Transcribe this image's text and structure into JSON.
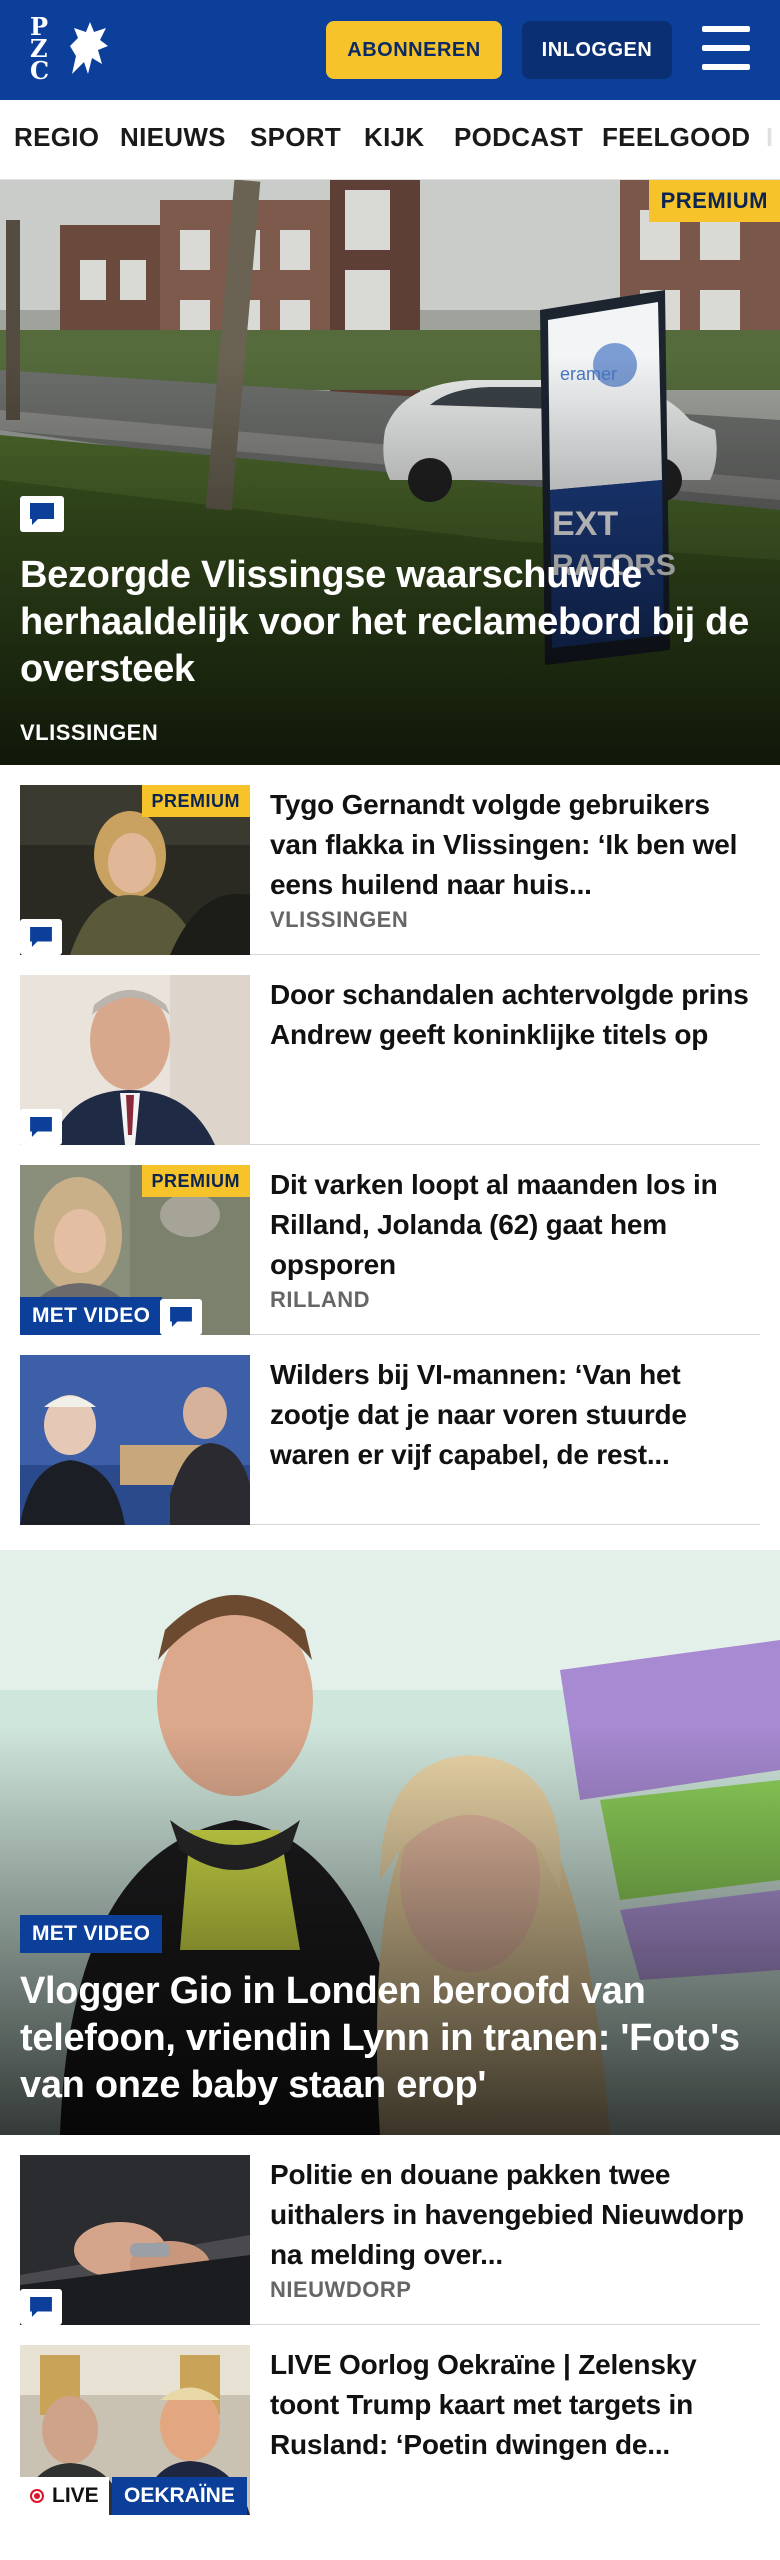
{
  "header": {
    "logo_text": "PZC",
    "subscribe_label": "ABONNEREN",
    "login_label": "INLOGGEN",
    "menu_icon": "hamburger-menu-icon"
  },
  "nav": {
    "items": [
      "REGIO",
      "NIEUWS",
      "SPORT",
      "KIJK",
      "PODCAST",
      "FEELGOOD",
      "I"
    ]
  },
  "hero1": {
    "badge": "PREMIUM",
    "title": "Bezorgde Vlissingse waarschuwde herhaaldelijk voor het reclamebord bij de oversteek",
    "location": "VLISSINGEN",
    "billboard_text": "EXT\nRATORS",
    "billboard_brand": "eramer"
  },
  "articles_a": [
    {
      "title": "Tygo Gernandt volgde gebruikers van flakka in Vlissingen: ‘Ik ben wel eens huilend naar huis...",
      "location": "VLISSINGEN",
      "premium": "PREMIUM"
    },
    {
      "title": "Door schandalen achtervolgde prins Andrew geeft koninklijke titels op",
      "location": ""
    },
    {
      "title": "Dit varken loopt al maanden los in Rilland, Jolanda (62) gaat hem opsporen",
      "location": "RILLAND",
      "premium": "PREMIUM",
      "video": "MET VIDEO"
    },
    {
      "title": "Wilders bij VI-mannen: ‘Van het zootje dat je naar voren stuurde waren er vijf capabel, de rest...",
      "location": ""
    }
  ],
  "hero2": {
    "video": "MET VIDEO",
    "title": "Vlogger Gio in Londen beroofd van telefoon, vriendin Lynn in tranen: 'Foto's van onze baby staan erop'"
  },
  "articles_b": [
    {
      "title": "Politie en douane pakken twee uithalers in havengebied Nieuwdorp na melding over...",
      "location": "NIEUWDORP"
    },
    {
      "title": "LIVE Oorlog Oekraïne | Zelensky toont Trump kaart met targets in Rusland: ‘Poetin dwingen de...",
      "live": "LIVE",
      "region": "OEKRAÏNE"
    }
  ],
  "colors": {
    "brand_blue": "#0c3f9a",
    "premium_yellow": "#f6c32a",
    "login_navy": "#0a2f73"
  }
}
